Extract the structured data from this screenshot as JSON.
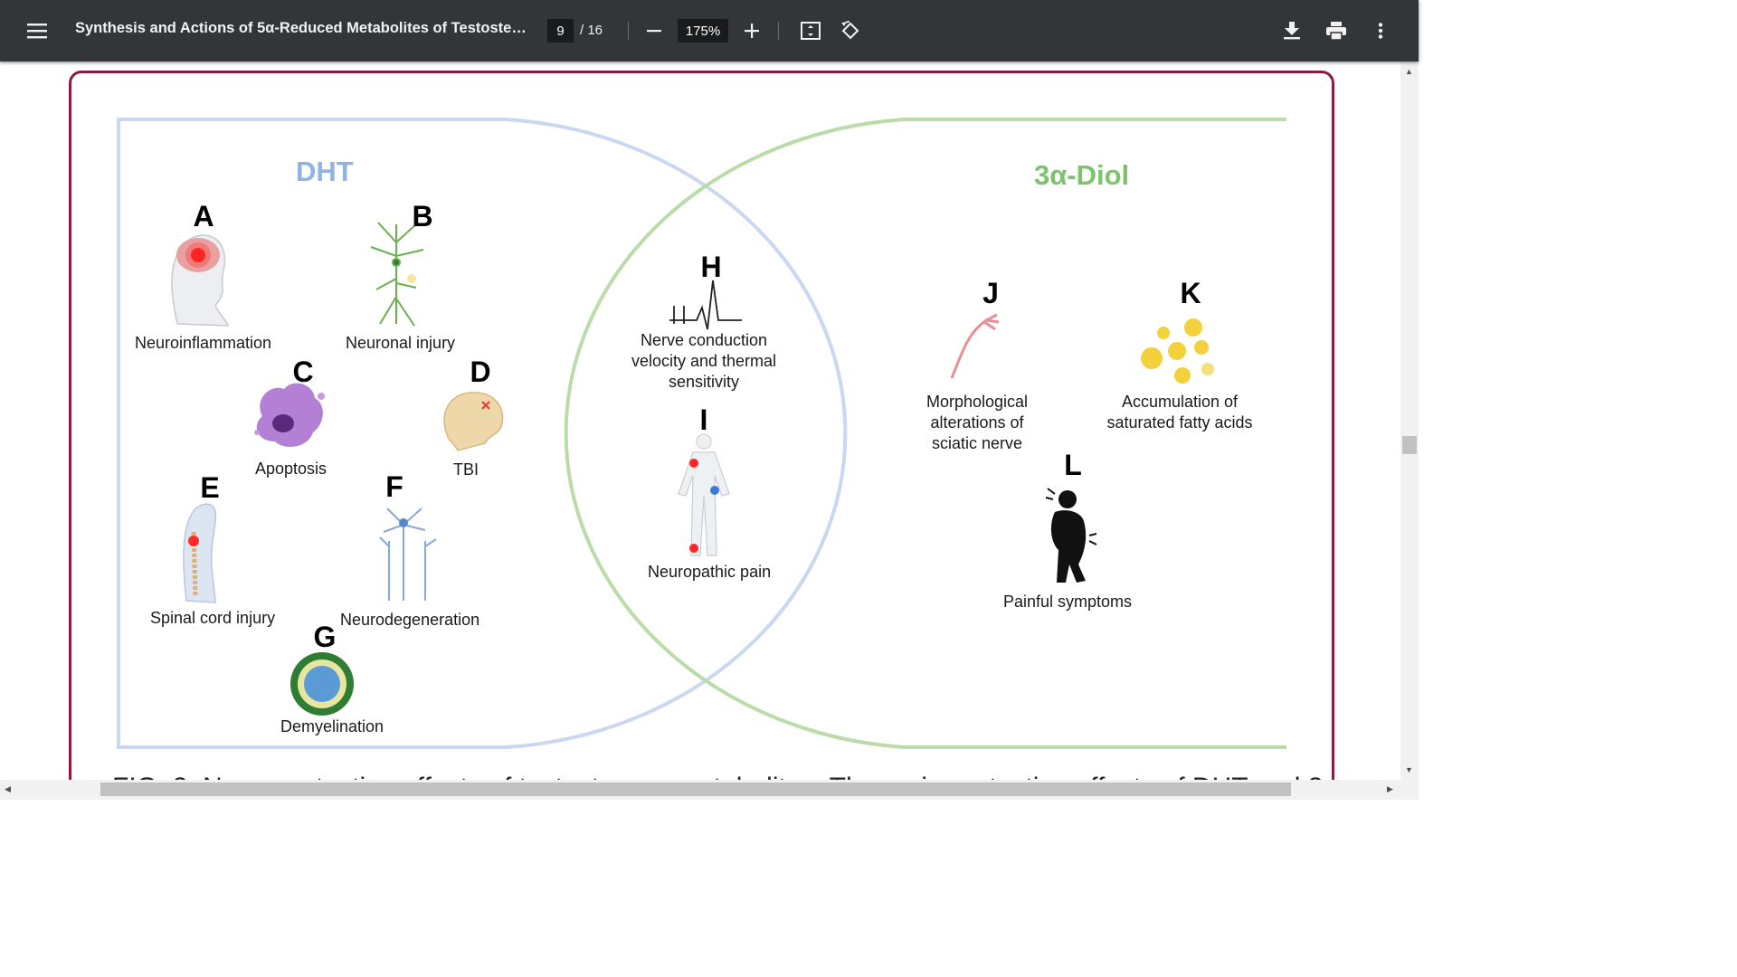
{
  "toolbar": {
    "menu_icon": "hamburger-menu-icon",
    "title": "Synthesis and Actions of 5α-Reduced Metabolites of Testoster...",
    "page_current": "9",
    "page_total": "/ 16",
    "zoom": "175%",
    "icons": [
      "zoom-out-icon",
      "zoom-in-icon",
      "fit-page-icon",
      "rotate-icon",
      "download-icon",
      "print-icon",
      "more-vert-icon"
    ]
  },
  "figure": {
    "dht_title": "DHT",
    "diol_title": "3α-Diol",
    "items": [
      {
        "letter": "A",
        "label": "Neuroinflammation"
      },
      {
        "letter": "B",
        "label": "Neuronal injury"
      },
      {
        "letter": "C",
        "label": "Apoptosis"
      },
      {
        "letter": "D",
        "label": "TBI"
      },
      {
        "letter": "E",
        "label": "Spinal cord injury"
      },
      {
        "letter": "F",
        "label": "Neurodegeneration"
      },
      {
        "letter": "G",
        "label": "Demyelination"
      },
      {
        "letter": "H",
        "label_lines": [
          "Nerve conduction",
          "velocity and thermal",
          "sensitivity"
        ]
      },
      {
        "letter": "I",
        "label": "Neuropathic pain"
      },
      {
        "letter": "J",
        "label_lines": [
          "Morphological",
          "alterations of",
          "sciatic nerve"
        ]
      },
      {
        "letter": "K",
        "label_lines": [
          "Accumulation of",
          "saturated fatty acids"
        ]
      },
      {
        "letter": "L",
        "label": "Painful symptoms"
      }
    ],
    "colors": {
      "dht": "#8fb4e3",
      "diol": "#7ec26b",
      "frame": "#8a1c3f"
    }
  },
  "caption_partial": "FIG. 2.  Neuroprotective effects of testosterone metabolites. The main protective effects of DHT and 3"
}
